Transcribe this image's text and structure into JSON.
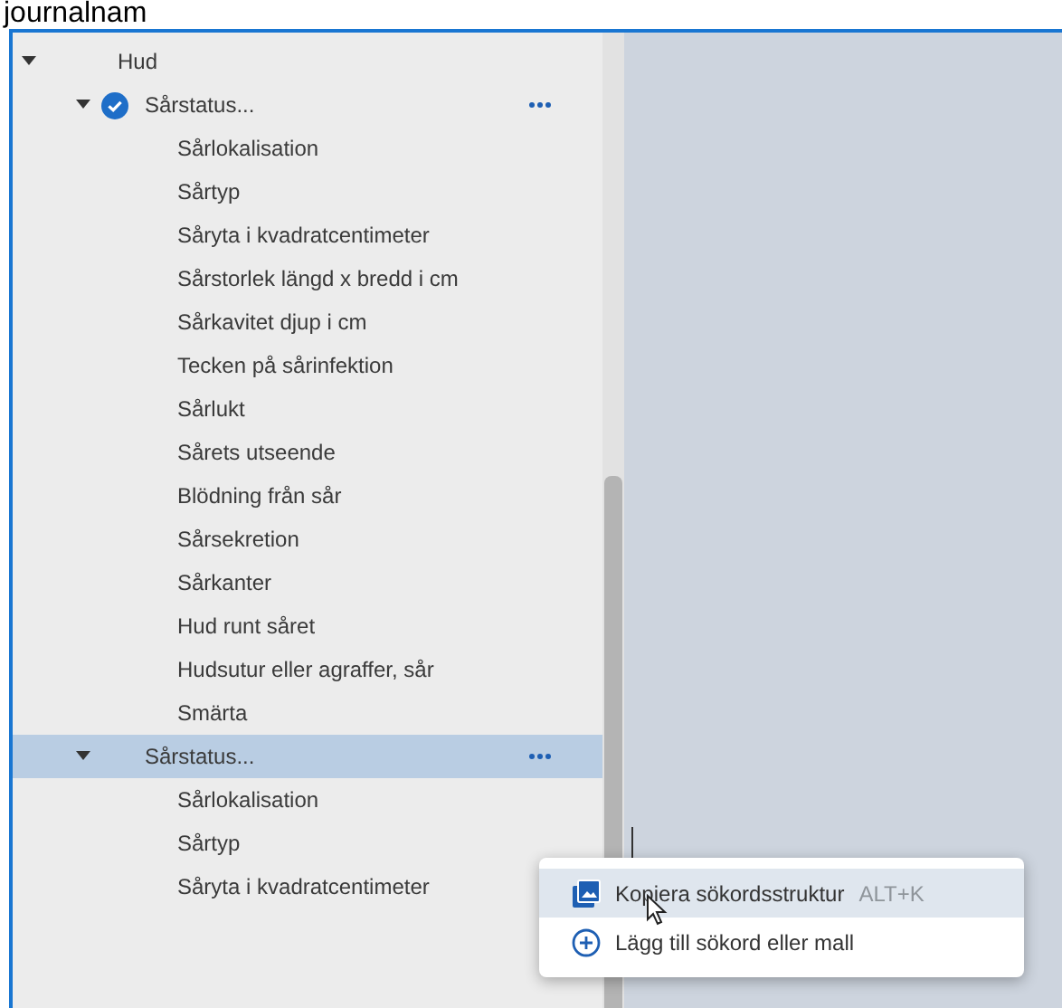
{
  "heading": "journalnam",
  "tree": [
    {
      "label": "Hud",
      "expanded": true,
      "selected": false,
      "children": [
        {
          "label": "Sårstatus...",
          "expanded": true,
          "checked": true,
          "selected": false,
          "children": [
            {
              "label": "Sårlokalisation",
              "selected": false
            },
            {
              "label": "Sårtyp",
              "selected": false
            },
            {
              "label": "Såryta i kvadratcentimeter",
              "selected": false
            },
            {
              "label": "Sårstorlek längd x bredd i cm",
              "selected": false
            },
            {
              "label": "Sårkavitet djup i cm",
              "selected": false
            },
            {
              "label": "Tecken på sårinfektion",
              "selected": false
            },
            {
              "label": "Sårlukt",
              "selected": false
            },
            {
              "label": "Sårets utseende",
              "selected": false
            },
            {
              "label": "Blödning från sår",
              "selected": false
            },
            {
              "label": "Sårsekretion",
              "selected": false
            },
            {
              "label": "Sårkanter",
              "selected": false
            },
            {
              "label": "Hud runt såret",
              "selected": false
            },
            {
              "label": "Hudsutur eller agraffer, sår",
              "selected": false
            },
            {
              "label": "Smärta",
              "selected": false
            }
          ]
        },
        {
          "label": "Sårstatus...",
          "expanded": true,
          "checked": false,
          "selected": true,
          "children": [
            {
              "label": "Sårlokalisation",
              "selected": false
            },
            {
              "label": "Sårtyp",
              "selected": false
            },
            {
              "label": "Såryta i kvadratcentimeter",
              "selected": false
            }
          ]
        }
      ]
    }
  ],
  "context_menu": [
    {
      "kind": "copy",
      "label": "Kopiera sökordsstruktur",
      "shortcut": "ALT+K",
      "selected": true
    },
    {
      "kind": "add",
      "label": "Lägg till sökord eller mall",
      "selected": false
    }
  ]
}
